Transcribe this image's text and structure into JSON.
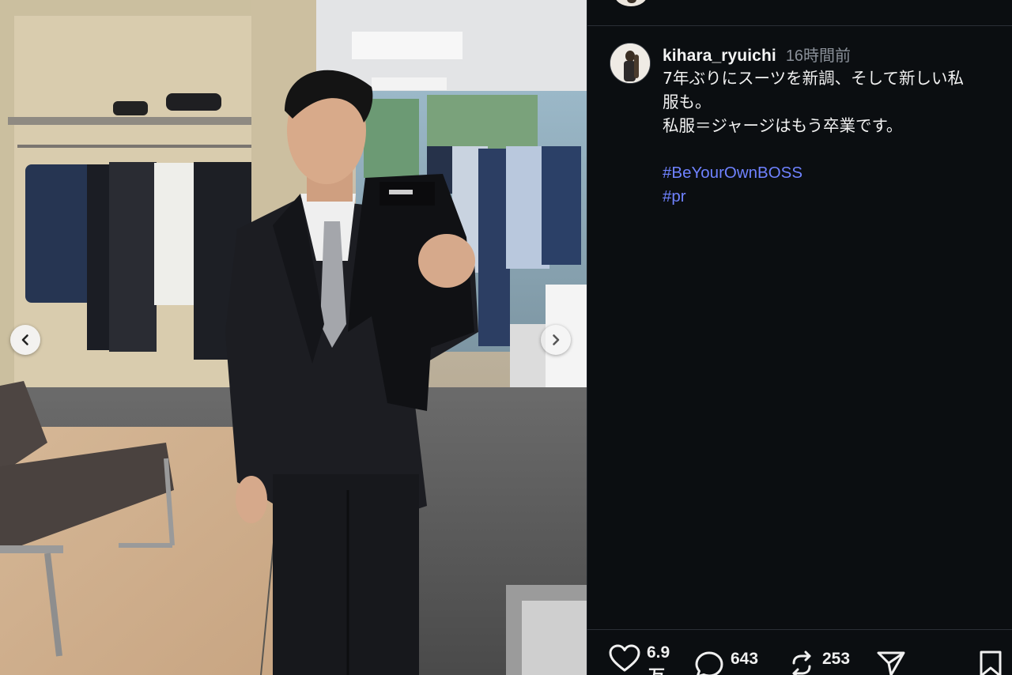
{
  "carousel": {
    "prev_icon": "chevron-left-icon",
    "next_icon": "chevron-right-icon"
  },
  "post": {
    "username": "kihara_ryuichi",
    "time": "16時間前",
    "caption_lines": [
      "7年ぶりにスーツを新調、そして新しい私",
      "服も。",
      "私服＝ジャージはもう卒業です。"
    ],
    "hashtags": [
      "#BeYourOwnBOSS",
      "#pr"
    ]
  },
  "actions": {
    "like_count_top": "6.9",
    "like_count_bottom": "万",
    "comment_count": "643",
    "repost_count": "253",
    "icons": [
      "heart-icon",
      "comment-icon",
      "repost-icon",
      "share-icon",
      "bookmark-icon"
    ]
  },
  "colors": {
    "background": "#0b0e11",
    "text": "#f2f2f2",
    "muted": "#8a9099",
    "hashtag": "#6f82ff"
  }
}
